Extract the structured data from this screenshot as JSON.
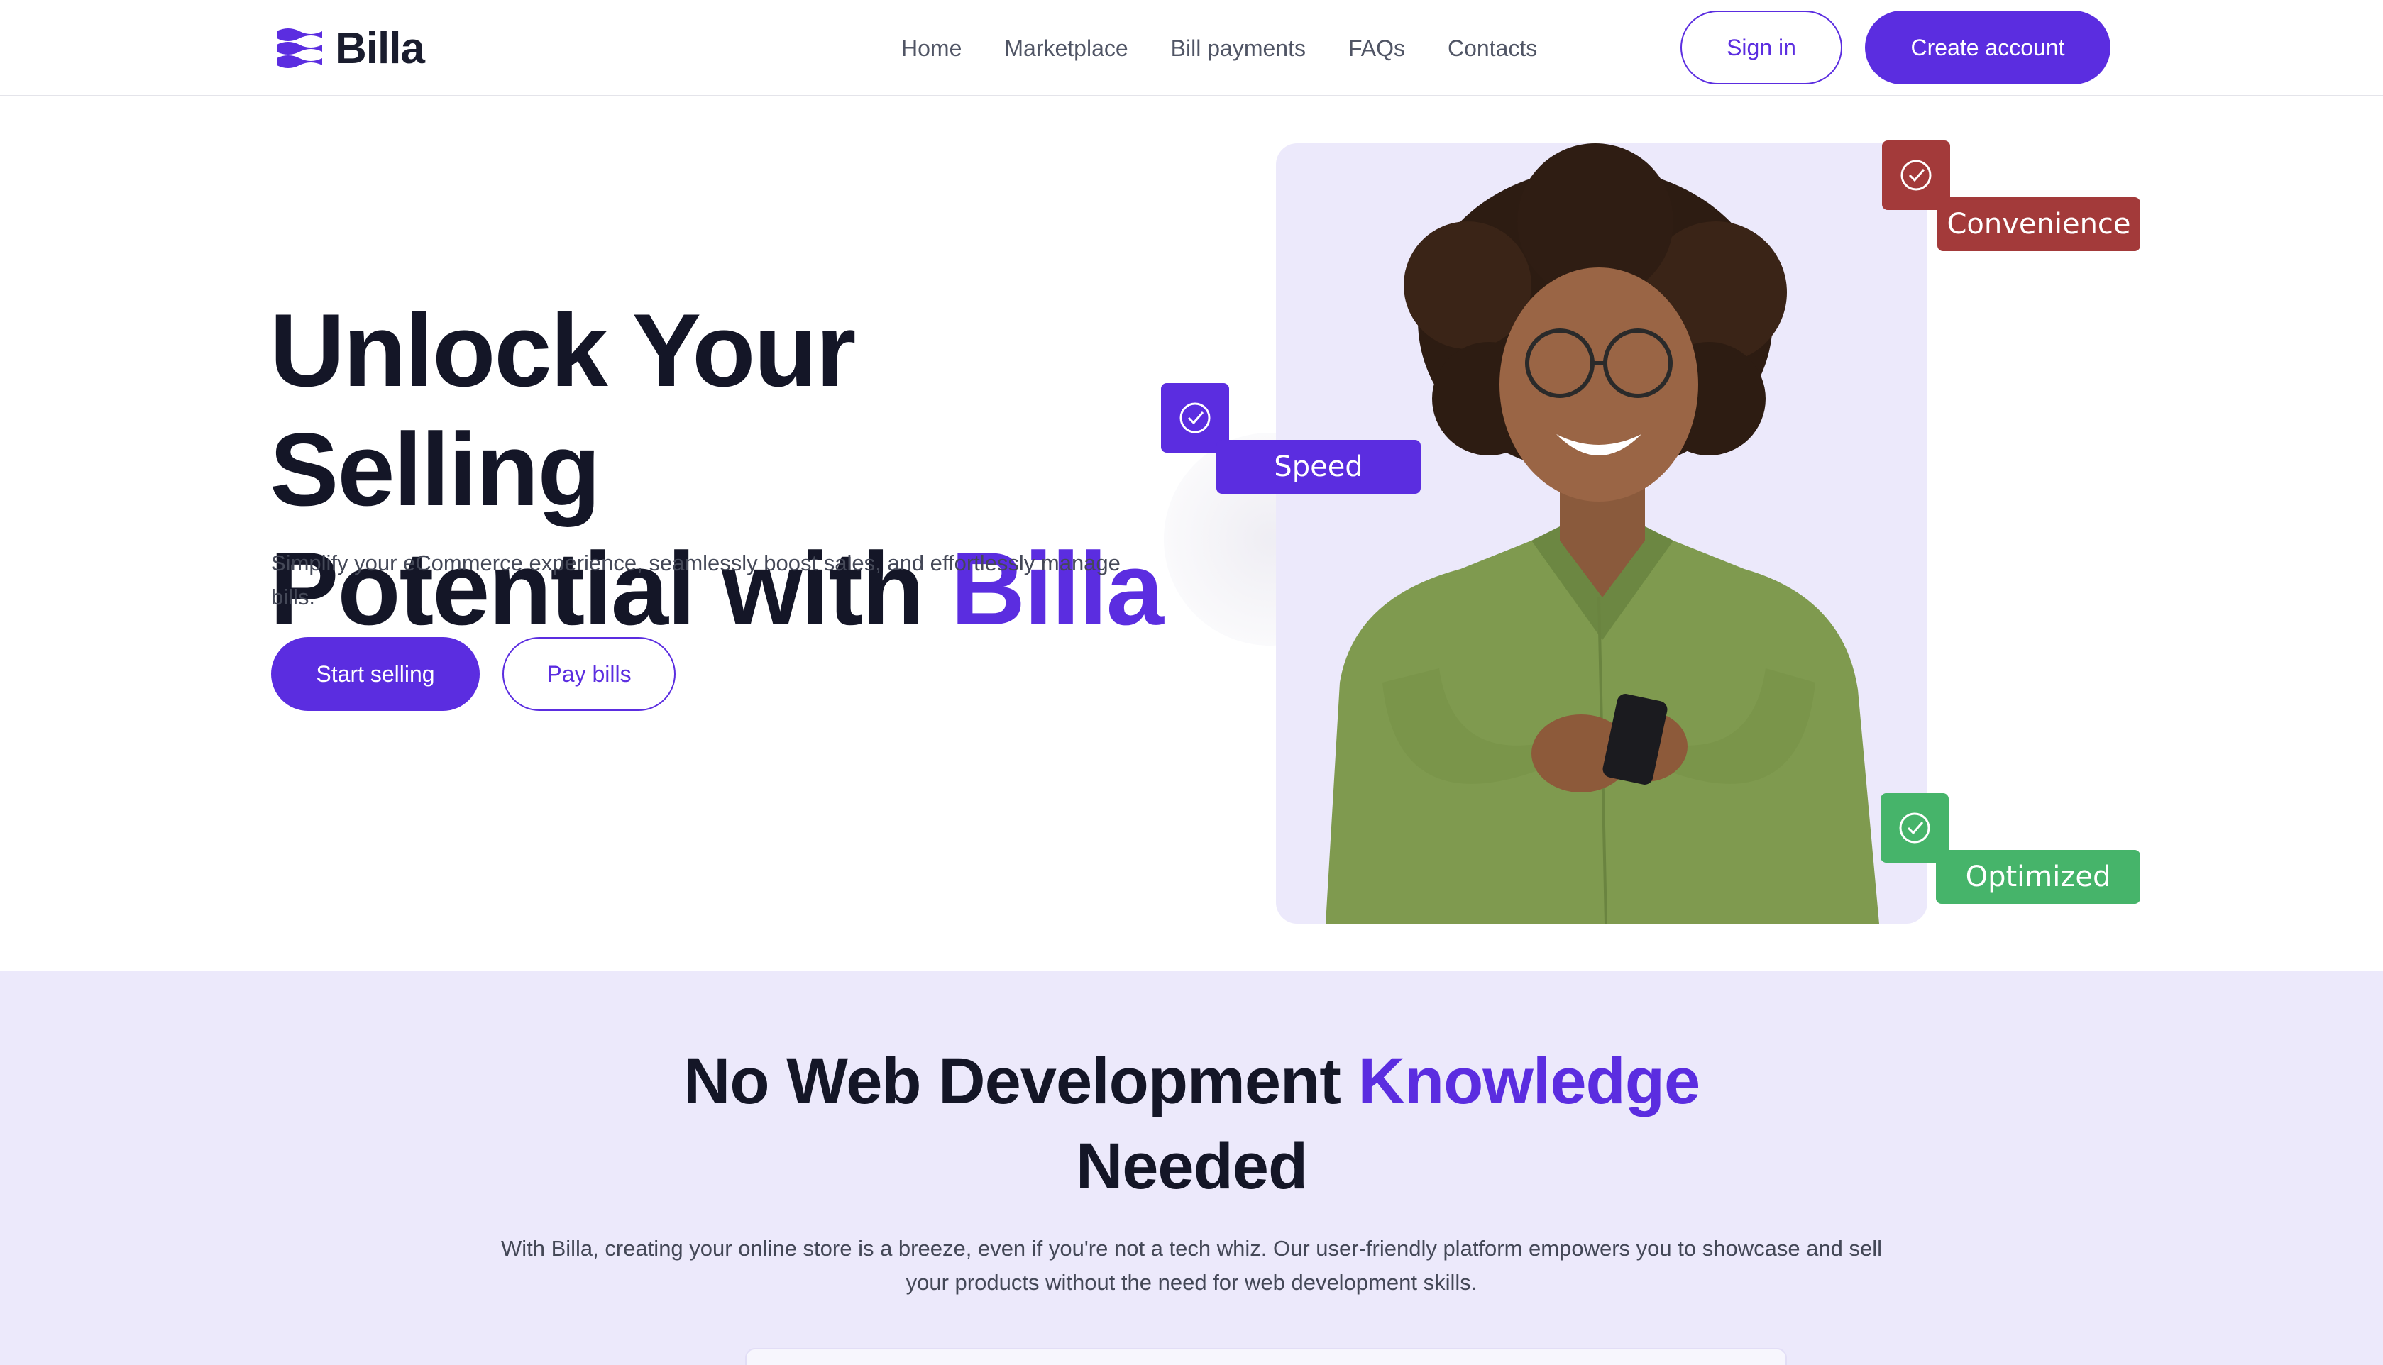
{
  "brand": {
    "name": "Billa",
    "accent_color": "#5b2de0"
  },
  "nav": {
    "items": [
      {
        "label": "Home"
      },
      {
        "label": "Marketplace"
      },
      {
        "label": "Bill payments"
      },
      {
        "label": "FAQs"
      },
      {
        "label": "Contacts"
      }
    ],
    "sign_in": "Sign in",
    "create_account": "Create account"
  },
  "hero": {
    "title_line1": "Unlock Your Selling",
    "title_line2_prefix": "Potential with ",
    "title_line2_accent": "Billa",
    "subtitle": "Simplify your eCommerce experience, seamlessly boost sales, and effortlessly manage bills.",
    "primary_button": "Start selling",
    "secondary_button": "Pay bills",
    "badges": [
      {
        "label": "Convenience",
        "color": "#a33a3a"
      },
      {
        "label": "Speed",
        "color": "#5b2de0"
      },
      {
        "label": "Optimized",
        "color": "#46b46a"
      }
    ]
  },
  "features": {
    "title_prefix": "No Web Development ",
    "title_accent": "Knowledge",
    "title_suffix": "Needed",
    "description": "With Billa, creating your online store is a breeze, even if you're not a tech whiz. Our user-friendly platform empowers you to showcase and sell your products without the need for web development skills."
  }
}
